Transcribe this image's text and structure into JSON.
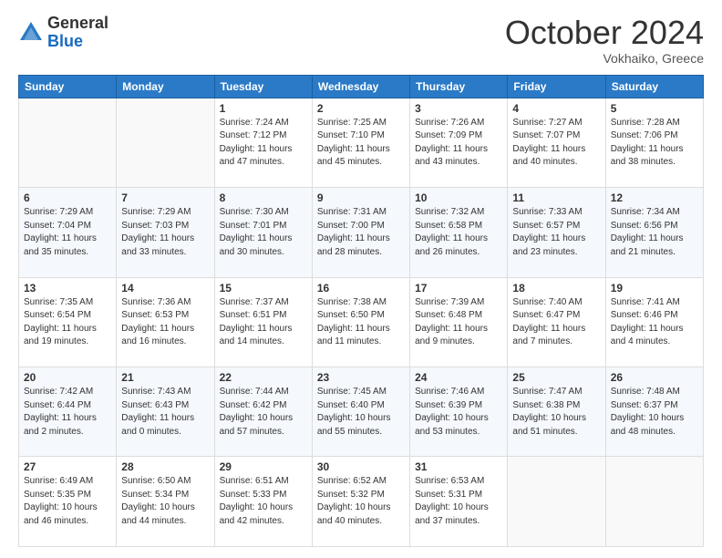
{
  "logo": {
    "general": "General",
    "blue": "Blue"
  },
  "header": {
    "month": "October 2024",
    "location": "Vokhaiko, Greece"
  },
  "weekdays": [
    "Sunday",
    "Monday",
    "Tuesday",
    "Wednesday",
    "Thursday",
    "Friday",
    "Saturday"
  ],
  "weeks": [
    [
      {
        "day": "",
        "sunrise": "",
        "sunset": "",
        "daylight": ""
      },
      {
        "day": "",
        "sunrise": "",
        "sunset": "",
        "daylight": ""
      },
      {
        "day": "1",
        "sunrise": "Sunrise: 7:24 AM",
        "sunset": "Sunset: 7:12 PM",
        "daylight": "Daylight: 11 hours and 47 minutes."
      },
      {
        "day": "2",
        "sunrise": "Sunrise: 7:25 AM",
        "sunset": "Sunset: 7:10 PM",
        "daylight": "Daylight: 11 hours and 45 minutes."
      },
      {
        "day": "3",
        "sunrise": "Sunrise: 7:26 AM",
        "sunset": "Sunset: 7:09 PM",
        "daylight": "Daylight: 11 hours and 43 minutes."
      },
      {
        "day": "4",
        "sunrise": "Sunrise: 7:27 AM",
        "sunset": "Sunset: 7:07 PM",
        "daylight": "Daylight: 11 hours and 40 minutes."
      },
      {
        "day": "5",
        "sunrise": "Sunrise: 7:28 AM",
        "sunset": "Sunset: 7:06 PM",
        "daylight": "Daylight: 11 hours and 38 minutes."
      }
    ],
    [
      {
        "day": "6",
        "sunrise": "Sunrise: 7:29 AM",
        "sunset": "Sunset: 7:04 PM",
        "daylight": "Daylight: 11 hours and 35 minutes."
      },
      {
        "day": "7",
        "sunrise": "Sunrise: 7:29 AM",
        "sunset": "Sunset: 7:03 PM",
        "daylight": "Daylight: 11 hours and 33 minutes."
      },
      {
        "day": "8",
        "sunrise": "Sunrise: 7:30 AM",
        "sunset": "Sunset: 7:01 PM",
        "daylight": "Daylight: 11 hours and 30 minutes."
      },
      {
        "day": "9",
        "sunrise": "Sunrise: 7:31 AM",
        "sunset": "Sunset: 7:00 PM",
        "daylight": "Daylight: 11 hours and 28 minutes."
      },
      {
        "day": "10",
        "sunrise": "Sunrise: 7:32 AM",
        "sunset": "Sunset: 6:58 PM",
        "daylight": "Daylight: 11 hours and 26 minutes."
      },
      {
        "day": "11",
        "sunrise": "Sunrise: 7:33 AM",
        "sunset": "Sunset: 6:57 PM",
        "daylight": "Daylight: 11 hours and 23 minutes."
      },
      {
        "day": "12",
        "sunrise": "Sunrise: 7:34 AM",
        "sunset": "Sunset: 6:56 PM",
        "daylight": "Daylight: 11 hours and 21 minutes."
      }
    ],
    [
      {
        "day": "13",
        "sunrise": "Sunrise: 7:35 AM",
        "sunset": "Sunset: 6:54 PM",
        "daylight": "Daylight: 11 hours and 19 minutes."
      },
      {
        "day": "14",
        "sunrise": "Sunrise: 7:36 AM",
        "sunset": "Sunset: 6:53 PM",
        "daylight": "Daylight: 11 hours and 16 minutes."
      },
      {
        "day": "15",
        "sunrise": "Sunrise: 7:37 AM",
        "sunset": "Sunset: 6:51 PM",
        "daylight": "Daylight: 11 hours and 14 minutes."
      },
      {
        "day": "16",
        "sunrise": "Sunrise: 7:38 AM",
        "sunset": "Sunset: 6:50 PM",
        "daylight": "Daylight: 11 hours and 11 minutes."
      },
      {
        "day": "17",
        "sunrise": "Sunrise: 7:39 AM",
        "sunset": "Sunset: 6:48 PM",
        "daylight": "Daylight: 11 hours and 9 minutes."
      },
      {
        "day": "18",
        "sunrise": "Sunrise: 7:40 AM",
        "sunset": "Sunset: 6:47 PM",
        "daylight": "Daylight: 11 hours and 7 minutes."
      },
      {
        "day": "19",
        "sunrise": "Sunrise: 7:41 AM",
        "sunset": "Sunset: 6:46 PM",
        "daylight": "Daylight: 11 hours and 4 minutes."
      }
    ],
    [
      {
        "day": "20",
        "sunrise": "Sunrise: 7:42 AM",
        "sunset": "Sunset: 6:44 PM",
        "daylight": "Daylight: 11 hours and 2 minutes."
      },
      {
        "day": "21",
        "sunrise": "Sunrise: 7:43 AM",
        "sunset": "Sunset: 6:43 PM",
        "daylight": "Daylight: 11 hours and 0 minutes."
      },
      {
        "day": "22",
        "sunrise": "Sunrise: 7:44 AM",
        "sunset": "Sunset: 6:42 PM",
        "daylight": "Daylight: 10 hours and 57 minutes."
      },
      {
        "day": "23",
        "sunrise": "Sunrise: 7:45 AM",
        "sunset": "Sunset: 6:40 PM",
        "daylight": "Daylight: 10 hours and 55 minutes."
      },
      {
        "day": "24",
        "sunrise": "Sunrise: 7:46 AM",
        "sunset": "Sunset: 6:39 PM",
        "daylight": "Daylight: 10 hours and 53 minutes."
      },
      {
        "day": "25",
        "sunrise": "Sunrise: 7:47 AM",
        "sunset": "Sunset: 6:38 PM",
        "daylight": "Daylight: 10 hours and 51 minutes."
      },
      {
        "day": "26",
        "sunrise": "Sunrise: 7:48 AM",
        "sunset": "Sunset: 6:37 PM",
        "daylight": "Daylight: 10 hours and 48 minutes."
      }
    ],
    [
      {
        "day": "27",
        "sunrise": "Sunrise: 6:49 AM",
        "sunset": "Sunset: 5:35 PM",
        "daylight": "Daylight: 10 hours and 46 minutes."
      },
      {
        "day": "28",
        "sunrise": "Sunrise: 6:50 AM",
        "sunset": "Sunset: 5:34 PM",
        "daylight": "Daylight: 10 hours and 44 minutes."
      },
      {
        "day": "29",
        "sunrise": "Sunrise: 6:51 AM",
        "sunset": "Sunset: 5:33 PM",
        "daylight": "Daylight: 10 hours and 42 minutes."
      },
      {
        "day": "30",
        "sunrise": "Sunrise: 6:52 AM",
        "sunset": "Sunset: 5:32 PM",
        "daylight": "Daylight: 10 hours and 40 minutes."
      },
      {
        "day": "31",
        "sunrise": "Sunrise: 6:53 AM",
        "sunset": "Sunset: 5:31 PM",
        "daylight": "Daylight: 10 hours and 37 minutes."
      },
      {
        "day": "",
        "sunrise": "",
        "sunset": "",
        "daylight": ""
      },
      {
        "day": "",
        "sunrise": "",
        "sunset": "",
        "daylight": ""
      }
    ]
  ]
}
